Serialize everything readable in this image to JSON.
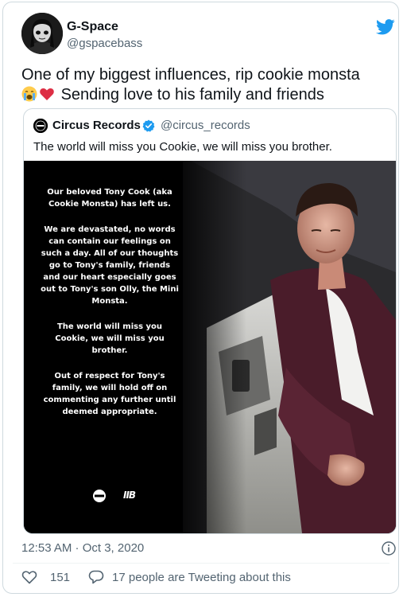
{
  "author": {
    "name": "G-Space",
    "handle": "@gspacebass"
  },
  "tweet": {
    "line1": "One of my biggest influences, rip cookie monsta",
    "line2": "Sending love to his family and friends"
  },
  "quote": {
    "name": "Circus Records",
    "handle": "@circus_records",
    "text": "The world will miss you Cookie, we will miss you brother.",
    "image": {
      "para1": "Our beloved Tony Cook (aka Cookie Monsta) has left us.",
      "para2": "We are devastated, no words can contain our feelings on such a day. All of our thoughts go to Tony's family, friends and our heart especially goes out to Tony's son Olly, the Mini Monsta.",
      "para3": "The world will miss you Cookie, we will miss you brother.",
      "para4": "Out of respect for Tony's family, we will hold off on commenting any further until deemed appropriate.",
      "logo_text": "IIB"
    }
  },
  "meta": {
    "timestamp": "12:53 AM · Oct 3, 2020"
  },
  "actions": {
    "likes": "151",
    "replies": "17 people are Tweeting about this"
  },
  "colors": {
    "twitter_blue": "#1d9bf0",
    "like_red": "#e0245e",
    "text_secondary": "#536471"
  },
  "icons": {
    "brand": "twitter-bird-icon",
    "verified": "verified-badge-icon",
    "info": "info-icon",
    "like": "heart-icon",
    "reply": "speech-bubble-icon"
  }
}
